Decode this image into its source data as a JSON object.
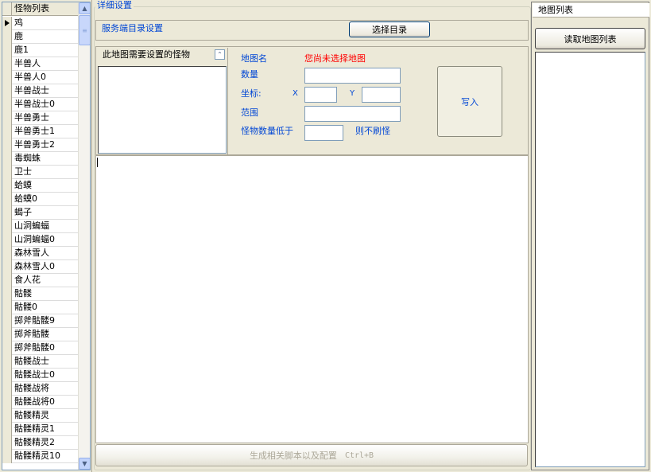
{
  "monster_list": {
    "header": "怪物列表",
    "items": [
      "鸡",
      "鹿",
      "鹿1",
      "半兽人",
      "半兽人0",
      "半兽战士",
      "半兽战士0",
      "半兽勇士",
      "半兽勇士1",
      "半兽勇士2",
      "毒蜘蛛",
      "卫士",
      "蛤蟆",
      "蛤蟆0",
      "蝎子",
      "山洞蝙蝠",
      "山洞蝙蝠0",
      "森林雪人",
      "森林雪人0",
      "食人花",
      "骷髅",
      "骷髅0",
      "掷斧骷髅9",
      "掷斧骷髅",
      "掷斧骷髅0",
      "骷髅战士",
      "骷髅战士0",
      "骷髅战将",
      "骷髅战将0",
      "骷髅精灵",
      "骷髅精灵1",
      "骷髅精灵2",
      "骷髅精灵10"
    ],
    "current_index": 0
  },
  "detail": {
    "legend": "详细设置",
    "server_dir_label": "服务端目录设置",
    "choose_dir_button": "选择目录",
    "monster_subgroup_title": "此地图需要设置的怪物",
    "map_name_label": "地图名",
    "map_name_value": "您尚未选择地图",
    "count_label": "数量",
    "coord_label": "坐标:",
    "x_label": "X",
    "y_label": "Y",
    "range_label": "范围",
    "threshold_label": "怪物数量低于",
    "threshold_suffix": "则不刷怪",
    "write_button": "写入",
    "generate_button": "生成相关脚本以及配置",
    "generate_shortcut": "Ctrl+B"
  },
  "map_list": {
    "title": "地图列表",
    "read_button": "读取地图列表"
  },
  "colors": {
    "window_bg": "#ece9d8",
    "label_blue": "#0046d5",
    "warning_red": "#ff0000",
    "disabled_text": "#aca899"
  }
}
